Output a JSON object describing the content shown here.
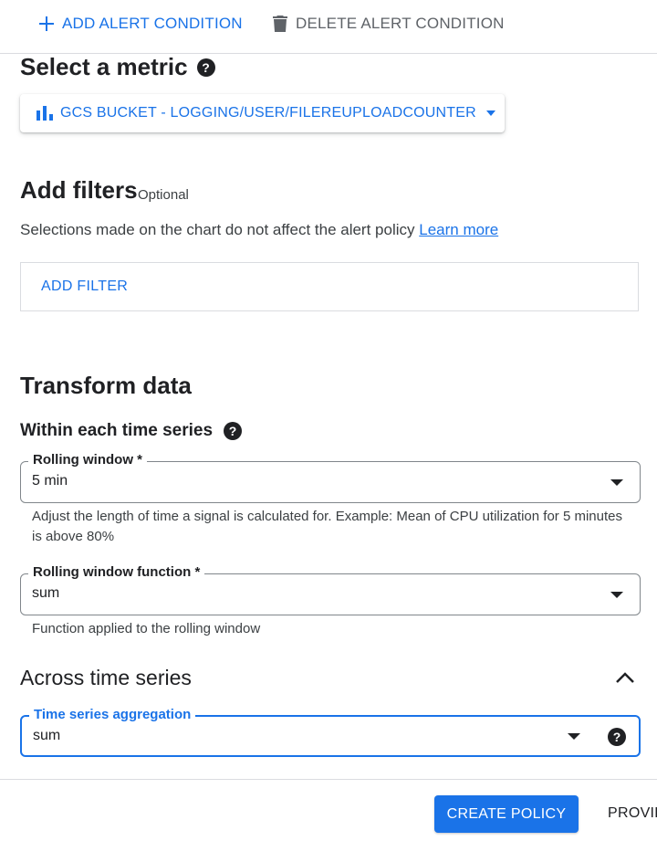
{
  "toolbar": {
    "add_label": "ADD ALERT CONDITION",
    "delete_label": "DELETE ALERT CONDITION"
  },
  "metric": {
    "heading": "Select a metric",
    "selected": "GCS BUCKET - LOGGING/USER/FILEREUPLOADCOUNTER"
  },
  "filters": {
    "heading": "Add filters",
    "optional_label": "Optional",
    "description": "Selections made on the chart do not affect the alert policy",
    "learn_more": "Learn more",
    "add_filter_label": "ADD FILTER"
  },
  "transform": {
    "heading": "Transform data",
    "within_heading": "Within each time series",
    "rolling_window": {
      "label": "Rolling window *",
      "value": "5 min",
      "hint": "Adjust the length of time a signal is calculated for. Example: Mean of CPU utilization for 5 minutes is above 80%"
    },
    "rolling_function": {
      "label": "Rolling window function *",
      "value": "sum",
      "hint": "Function applied to the rolling window"
    },
    "across_heading": "Across time series",
    "aggregation": {
      "label": "Time series aggregation",
      "value": "sum"
    }
  },
  "footer": {
    "create_label": "CREATE POLICY",
    "next_label": "PROVIDE"
  },
  "colors": {
    "accent": "#1a73e8",
    "text": "#202124",
    "muted": "#5f6368",
    "border": "#dadce0"
  },
  "icons": [
    "plus-icon",
    "trash-icon",
    "help-icon",
    "bar-chart-icon",
    "caret-down-icon",
    "chevron-up-icon"
  ]
}
